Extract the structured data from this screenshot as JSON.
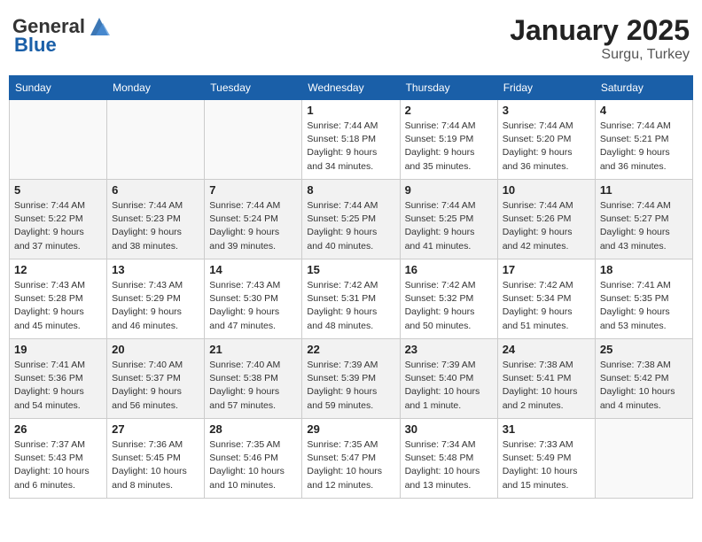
{
  "header": {
    "logo_general": "General",
    "logo_blue": "Blue",
    "month_year": "January 2025",
    "location": "Surgu, Turkey"
  },
  "weekdays": [
    "Sunday",
    "Monday",
    "Tuesday",
    "Wednesday",
    "Thursday",
    "Friday",
    "Saturday"
  ],
  "weeks": [
    [
      {
        "day": "",
        "info": ""
      },
      {
        "day": "",
        "info": ""
      },
      {
        "day": "",
        "info": ""
      },
      {
        "day": "1",
        "info": "Sunrise: 7:44 AM\nSunset: 5:18 PM\nDaylight: 9 hours and 34 minutes."
      },
      {
        "day": "2",
        "info": "Sunrise: 7:44 AM\nSunset: 5:19 PM\nDaylight: 9 hours and 35 minutes."
      },
      {
        "day": "3",
        "info": "Sunrise: 7:44 AM\nSunset: 5:20 PM\nDaylight: 9 hours and 36 minutes."
      },
      {
        "day": "4",
        "info": "Sunrise: 7:44 AM\nSunset: 5:21 PM\nDaylight: 9 hours and 36 minutes."
      }
    ],
    [
      {
        "day": "5",
        "info": "Sunrise: 7:44 AM\nSunset: 5:22 PM\nDaylight: 9 hours and 37 minutes."
      },
      {
        "day": "6",
        "info": "Sunrise: 7:44 AM\nSunset: 5:23 PM\nDaylight: 9 hours and 38 minutes."
      },
      {
        "day": "7",
        "info": "Sunrise: 7:44 AM\nSunset: 5:24 PM\nDaylight: 9 hours and 39 minutes."
      },
      {
        "day": "8",
        "info": "Sunrise: 7:44 AM\nSunset: 5:25 PM\nDaylight: 9 hours and 40 minutes."
      },
      {
        "day": "9",
        "info": "Sunrise: 7:44 AM\nSunset: 5:25 PM\nDaylight: 9 hours and 41 minutes."
      },
      {
        "day": "10",
        "info": "Sunrise: 7:44 AM\nSunset: 5:26 PM\nDaylight: 9 hours and 42 minutes."
      },
      {
        "day": "11",
        "info": "Sunrise: 7:44 AM\nSunset: 5:27 PM\nDaylight: 9 hours and 43 minutes."
      }
    ],
    [
      {
        "day": "12",
        "info": "Sunrise: 7:43 AM\nSunset: 5:28 PM\nDaylight: 9 hours and 45 minutes."
      },
      {
        "day": "13",
        "info": "Sunrise: 7:43 AM\nSunset: 5:29 PM\nDaylight: 9 hours and 46 minutes."
      },
      {
        "day": "14",
        "info": "Sunrise: 7:43 AM\nSunset: 5:30 PM\nDaylight: 9 hours and 47 minutes."
      },
      {
        "day": "15",
        "info": "Sunrise: 7:42 AM\nSunset: 5:31 PM\nDaylight: 9 hours and 48 minutes."
      },
      {
        "day": "16",
        "info": "Sunrise: 7:42 AM\nSunset: 5:32 PM\nDaylight: 9 hours and 50 minutes."
      },
      {
        "day": "17",
        "info": "Sunrise: 7:42 AM\nSunset: 5:34 PM\nDaylight: 9 hours and 51 minutes."
      },
      {
        "day": "18",
        "info": "Sunrise: 7:41 AM\nSunset: 5:35 PM\nDaylight: 9 hours and 53 minutes."
      }
    ],
    [
      {
        "day": "19",
        "info": "Sunrise: 7:41 AM\nSunset: 5:36 PM\nDaylight: 9 hours and 54 minutes."
      },
      {
        "day": "20",
        "info": "Sunrise: 7:40 AM\nSunset: 5:37 PM\nDaylight: 9 hours and 56 minutes."
      },
      {
        "day": "21",
        "info": "Sunrise: 7:40 AM\nSunset: 5:38 PM\nDaylight: 9 hours and 57 minutes."
      },
      {
        "day": "22",
        "info": "Sunrise: 7:39 AM\nSunset: 5:39 PM\nDaylight: 9 hours and 59 minutes."
      },
      {
        "day": "23",
        "info": "Sunrise: 7:39 AM\nSunset: 5:40 PM\nDaylight: 10 hours and 1 minute."
      },
      {
        "day": "24",
        "info": "Sunrise: 7:38 AM\nSunset: 5:41 PM\nDaylight: 10 hours and 2 minutes."
      },
      {
        "day": "25",
        "info": "Sunrise: 7:38 AM\nSunset: 5:42 PM\nDaylight: 10 hours and 4 minutes."
      }
    ],
    [
      {
        "day": "26",
        "info": "Sunrise: 7:37 AM\nSunset: 5:43 PM\nDaylight: 10 hours and 6 minutes."
      },
      {
        "day": "27",
        "info": "Sunrise: 7:36 AM\nSunset: 5:45 PM\nDaylight: 10 hours and 8 minutes."
      },
      {
        "day": "28",
        "info": "Sunrise: 7:35 AM\nSunset: 5:46 PM\nDaylight: 10 hours and 10 minutes."
      },
      {
        "day": "29",
        "info": "Sunrise: 7:35 AM\nSunset: 5:47 PM\nDaylight: 10 hours and 12 minutes."
      },
      {
        "day": "30",
        "info": "Sunrise: 7:34 AM\nSunset: 5:48 PM\nDaylight: 10 hours and 13 minutes."
      },
      {
        "day": "31",
        "info": "Sunrise: 7:33 AM\nSunset: 5:49 PM\nDaylight: 10 hours and 15 minutes."
      },
      {
        "day": "",
        "info": ""
      }
    ]
  ]
}
